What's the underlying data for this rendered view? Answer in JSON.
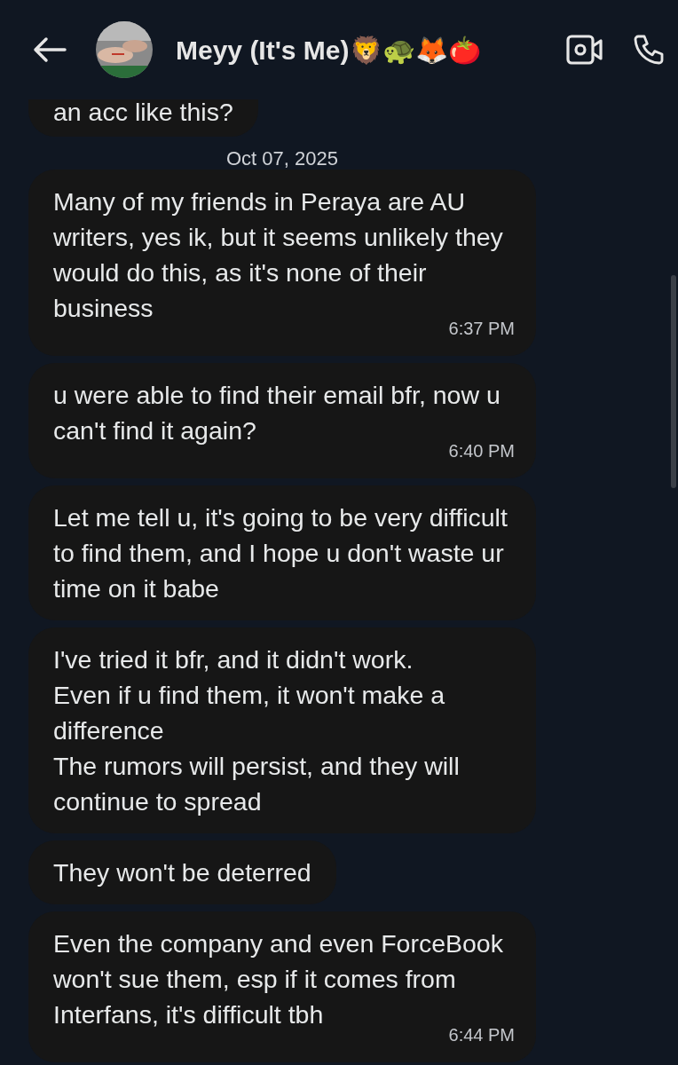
{
  "header": {
    "title": "Meyy (It's Me)🦁🐢🦊🍅"
  },
  "date_divider": "Oct 07, 2025",
  "messages": [
    {
      "text": "an acc like this?"
    },
    {
      "text": "Many of my friends in Peraya are AU writers, yes ik, but it seems unlikely they would do this, as it's none of their business",
      "time": "6:37 PM"
    },
    {
      "text": "u were able to find their email bfr, now u can't find it again?",
      "time": "6:40 PM"
    },
    {
      "text": "Let me tell u, it's going to be very difficult to find them, and I hope u don't waste ur time on it babe"
    },
    {
      "text": "I've tried it bfr, and it didn't work.\nEven if u find them, it won't make a difference\nThe rumors will persist, and they will continue to spread"
    },
    {
      "text": "They won't be deterred"
    },
    {
      "text": "Even the company and even ForceBook won't sue them, esp if it comes from Interfans, it's difficult tbh",
      "time": "6:44 PM"
    }
  ]
}
